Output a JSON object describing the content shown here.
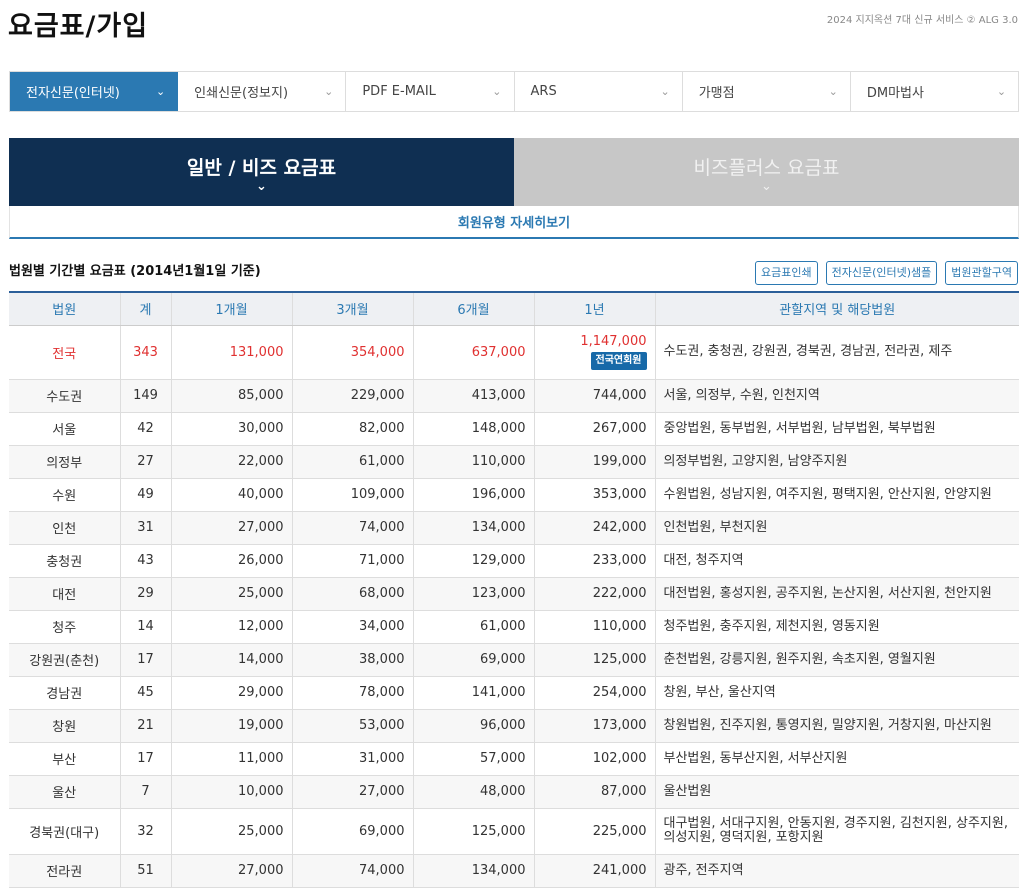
{
  "page": {
    "title": "요금표/가입",
    "top_note": "2024 지지옥션 7대 신규 서비스 ② ALG 3.0"
  },
  "tabs": [
    {
      "label": "전자신문(인터넷)"
    },
    {
      "label": "인쇄신문(정보지)"
    },
    {
      "label": "PDF E-MAIL"
    },
    {
      "label": "ARS"
    },
    {
      "label": "가맹점"
    },
    {
      "label": "DM마법사"
    }
  ],
  "plan_tabs": [
    {
      "label": "일반 / 비즈 요금표"
    },
    {
      "label": "비즈플러스 요금표"
    }
  ],
  "detail_link": "회원유형 자세히보기",
  "section_title": "법원별 기간별 요금표 (2014년1월1일 기준)",
  "buttons": {
    "print": "요금표인쇄",
    "sample": "전자신문(인터넷)샘플",
    "jurisdiction": "법원관할구역"
  },
  "table": {
    "headers": [
      "법원",
      "계",
      "1개월",
      "3개월",
      "6개월",
      "1년",
      "관할지역 및 해당법원"
    ],
    "national_badge": "전국연회원",
    "rows": [
      {
        "court": "전국",
        "count": "343",
        "m1": "131,000",
        "m3": "354,000",
        "m6": "637,000",
        "y1": "1,147,000",
        "area": "수도권, 충청권, 강원권, 경북권, 경남권, 전라권, 제주"
      },
      {
        "court": "수도권",
        "count": "149",
        "m1": "85,000",
        "m3": "229,000",
        "m6": "413,000",
        "y1": "744,000",
        "area": "서울, 의정부, 수원, 인천지역"
      },
      {
        "court": "서울",
        "count": "42",
        "m1": "30,000",
        "m3": "82,000",
        "m6": "148,000",
        "y1": "267,000",
        "area": "중앙법원, 동부법원, 서부법원, 남부법원, 북부법원"
      },
      {
        "court": "의정부",
        "count": "27",
        "m1": "22,000",
        "m3": "61,000",
        "m6": "110,000",
        "y1": "199,000",
        "area": "의정부법원, 고양지원, 남양주지원"
      },
      {
        "court": "수원",
        "count": "49",
        "m1": "40,000",
        "m3": "109,000",
        "m6": "196,000",
        "y1": "353,000",
        "area": "수원법원, 성남지원, 여주지원, 평택지원, 안산지원, 안양지원"
      },
      {
        "court": "인천",
        "count": "31",
        "m1": "27,000",
        "m3": "74,000",
        "m6": "134,000",
        "y1": "242,000",
        "area": "인천법원, 부천지원"
      },
      {
        "court": "충청권",
        "count": "43",
        "m1": "26,000",
        "m3": "71,000",
        "m6": "129,000",
        "y1": "233,000",
        "area": "대전, 청주지역"
      },
      {
        "court": "대전",
        "count": "29",
        "m1": "25,000",
        "m3": "68,000",
        "m6": "123,000",
        "y1": "222,000",
        "area": "대전법원, 홍성지원, 공주지원, 논산지원, 서산지원, 천안지원"
      },
      {
        "court": "청주",
        "count": "14",
        "m1": "12,000",
        "m3": "34,000",
        "m6": "61,000",
        "y1": "110,000",
        "area": "청주법원, 충주지원, 제천지원, 영동지원"
      },
      {
        "court": "강원권(춘천)",
        "count": "17",
        "m1": "14,000",
        "m3": "38,000",
        "m6": "69,000",
        "y1": "125,000",
        "area": "춘천법원, 강릉지원, 원주지원, 속초지원, 영월지원"
      },
      {
        "court": "경남권",
        "count": "45",
        "m1": "29,000",
        "m3": "78,000",
        "m6": "141,000",
        "y1": "254,000",
        "area": "창원, 부산, 울산지역"
      },
      {
        "court": "창원",
        "count": "21",
        "m1": "19,000",
        "m3": "53,000",
        "m6": "96,000",
        "y1": "173,000",
        "area": "창원법원, 진주지원, 통영지원, 밀양지원, 거창지원, 마산지원"
      },
      {
        "court": "부산",
        "count": "17",
        "m1": "11,000",
        "m3": "31,000",
        "m6": "57,000",
        "y1": "102,000",
        "area": "부산법원, 동부산지원, 서부산지원"
      },
      {
        "court": "울산",
        "count": "7",
        "m1": "10,000",
        "m3": "27,000",
        "m6": "48,000",
        "y1": "87,000",
        "area": "울산법원"
      },
      {
        "court": "경북권(대구)",
        "count": "32",
        "m1": "25,000",
        "m3": "69,000",
        "m6": "125,000",
        "y1": "225,000",
        "area": "대구법원, 서대구지원, 안동지원, 경주지원, 김천지원, 상주지원, 의성지원, 영덕지원, 포항지원"
      },
      {
        "court": "전라권",
        "count": "51",
        "m1": "27,000",
        "m3": "74,000",
        "m6": "134,000",
        "y1": "241,000",
        "area": "광주, 전주지역"
      }
    ]
  }
}
